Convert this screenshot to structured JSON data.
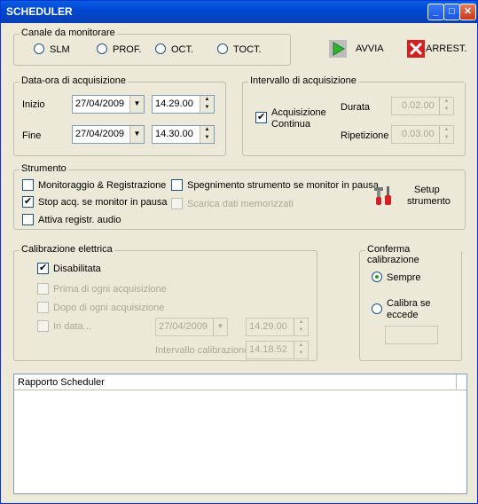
{
  "window": {
    "title": "SCHEDULER",
    "min": "_",
    "max": "□",
    "close": "✕"
  },
  "canale": {
    "label": "Canale da monitorare",
    "options": [
      "SLM",
      "PROF.",
      "OCT.",
      "TOCT."
    ]
  },
  "toolbar": {
    "start_label": "AVVIA",
    "stop_label": "ARREST."
  },
  "data_ora": {
    "label": "Data-ora di acquisizione",
    "inizio_label": "Inizio",
    "inizio_date": "27/04/2009",
    "inizio_time": "14.29.00",
    "fine_label": "Fine",
    "fine_date": "27/04/2009",
    "fine_time": "14.30.00"
  },
  "intervallo": {
    "label": "Intervallo di acquisizione",
    "continua_label_1": "Acquisizione",
    "continua_label_2": "Continua",
    "durata_label": "Durata",
    "durata_value": "0.02.00",
    "ripetizione_label": "Ripetizione",
    "ripetizione_value": "0.03.00"
  },
  "strumento": {
    "label": "Strumento",
    "monitor": "Monitoraggio & Registrazione",
    "stop_acq": "Stop acq. se monitor in pausa",
    "audio": "Attiva registr. audio",
    "spegnimento": "Spegnimento strumento se monitor in pausa",
    "scarica": "Scarica dati memorizzati",
    "setup_1": "Setup",
    "setup_2": "strumento"
  },
  "calibrazione": {
    "label": "Calibrazione elettrica",
    "disabilitata": "Disabilitata",
    "prima": "Prima di ogni acquisizione",
    "dopo": "Dopo di ogni acquisizione",
    "in_data": "In data...",
    "date": "27/04/2009",
    "time": "14.29.00",
    "intervallo_label": "Intervallo calibrazione",
    "intervallo_value": "14.18.52"
  },
  "conferma": {
    "label": "Conferma calibrazione",
    "sempre": "Sempre",
    "calibra_1": "Calibra se",
    "calibra_2": "eccede"
  },
  "rapporto": {
    "header": "Rapporto Scheduler"
  },
  "colors": {
    "title_bar": "#0047d6",
    "window_bg": "#ece9d8",
    "avvia_green": "#2fb52f",
    "arrest_red": "#d42020"
  }
}
